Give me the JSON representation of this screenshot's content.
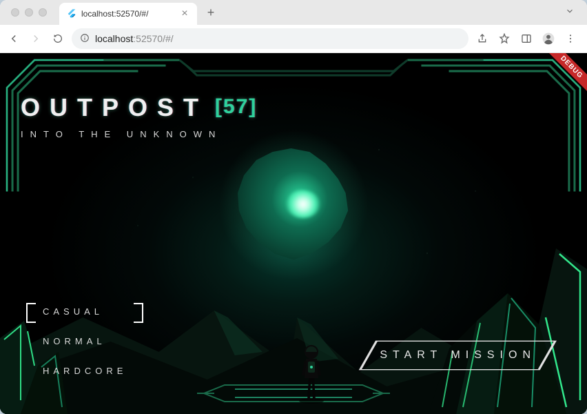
{
  "browser": {
    "tab_title": "localhost:52570/#/",
    "url_host": "localhost",
    "url_port_path": ":52570/#/"
  },
  "game": {
    "title": "OUTPOST",
    "title_number": "57",
    "subtitle": "INTO THE UNKNOWN",
    "debug_banner": "DEBUG",
    "difficulty": {
      "options": [
        "CASUAL",
        "NORMAL",
        "HARDCORE"
      ],
      "selected_index": 0
    },
    "start_button": "START MISSION",
    "colors": {
      "accent": "#2fd29b",
      "neon": "#37ff9a"
    }
  }
}
